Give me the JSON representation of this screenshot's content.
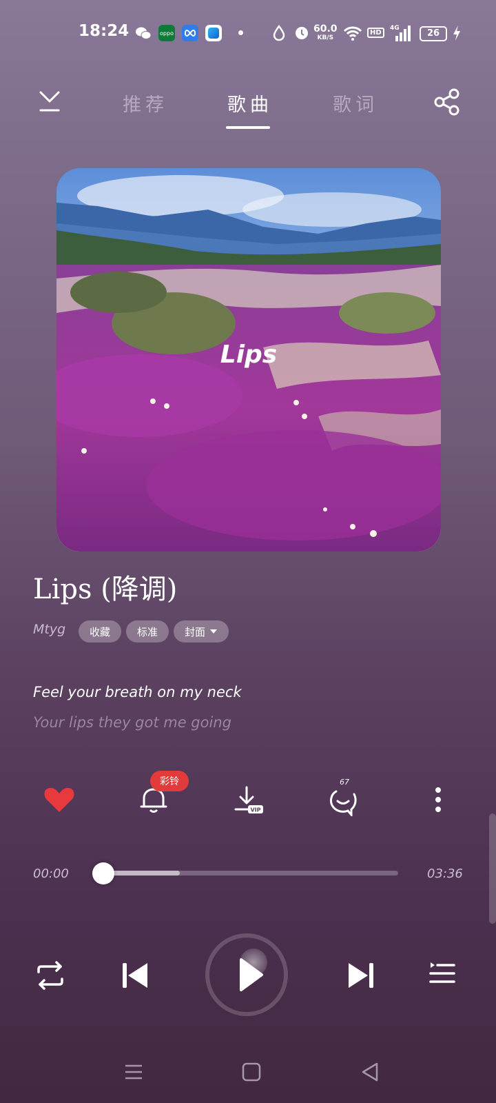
{
  "status_bar": {
    "time": "18:24",
    "app_icons": [
      "wechat-icon",
      "oppo-icon",
      "infinity-icon",
      "app-icon"
    ],
    "net_speed": "60.0",
    "net_unit": "KB/S",
    "hd": "HD",
    "network": "4G",
    "battery": "26"
  },
  "header": {
    "tabs": [
      {
        "label": "推荐",
        "active": false
      },
      {
        "label": "歌曲",
        "active": true
      },
      {
        "label": "歌词",
        "active": false
      }
    ]
  },
  "cover": {
    "title": "Lips"
  },
  "song": {
    "title": "Lips (降调)",
    "artist": "Mtyg",
    "chips": [
      "收藏",
      "标准",
      "封面"
    ]
  },
  "lyrics": {
    "current": "Feel your breath on my neck",
    "next": "Your lips they got me going"
  },
  "actions": {
    "ringtone_badge": "彩铃",
    "comment_count": "67"
  },
  "progress": {
    "elapsed": "00:00",
    "duration": "03:36",
    "buffered_fraction": 0.26,
    "played_fraction": 0.0
  },
  "colors": {
    "heart": "#e8393d",
    "badge": "#e23b3b"
  }
}
